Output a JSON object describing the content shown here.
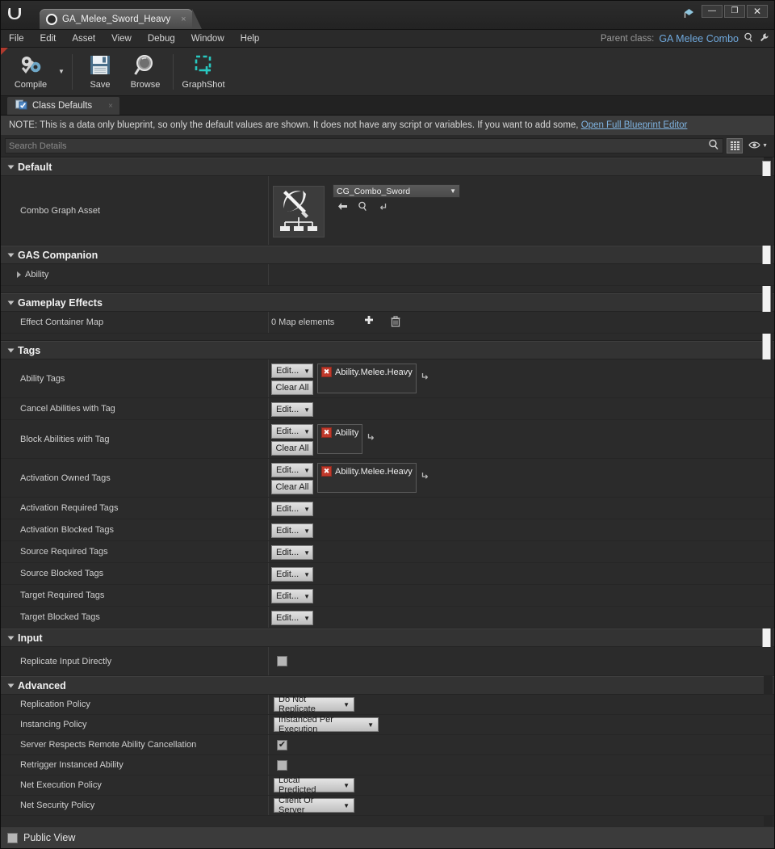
{
  "window": {
    "tab_title": "GA_Melee_Sword_Heavy",
    "tab_close": "×",
    "minimize": "—",
    "maximize": "❐",
    "close": "✕",
    "logo": "U"
  },
  "menubar": {
    "items": [
      "File",
      "Edit",
      "Asset",
      "View",
      "Debug",
      "Window",
      "Help"
    ],
    "parent_class_label": "Parent class:",
    "parent_class_value": "GA Melee Combo"
  },
  "toolbar": {
    "compile": "Compile",
    "save": "Save",
    "browse": "Browse",
    "graphshot": "GraphShot",
    "graphshot_color": "#28c8c0"
  },
  "doctab": {
    "label": "Class Defaults",
    "close": "×"
  },
  "note": {
    "text": "NOTE: This is a data only blueprint, so only the default values are shown.  It does not have any script or variables.  If you want to add some, ",
    "link": "Open Full Blueprint Editor"
  },
  "search": {
    "placeholder": "Search Details",
    "value": ""
  },
  "sections": {
    "default": {
      "title": "Default",
      "combo_graph_asset_label": "Combo Graph Asset",
      "combo_graph_asset_value": "CG_Combo_Sword"
    },
    "gas_companion": {
      "title": "GAS Companion",
      "ability_label": "Ability"
    },
    "gameplay_effects": {
      "title": "Gameplay Effects",
      "effect_container_map_label": "Effect Container Map",
      "effect_container_map_value": "0 Map elements"
    },
    "tags": {
      "title": "Tags",
      "edit_label": "Edit...",
      "clear_all_label": "Clear All",
      "rows": [
        {
          "label": "Ability Tags",
          "tags": [
            "Ability.Melee.Heavy"
          ],
          "has_clear": true
        },
        {
          "label": "Cancel Abilities with Tag",
          "tags": [],
          "has_clear": false
        },
        {
          "label": "Block Abilities with Tag",
          "tags": [
            "Ability"
          ],
          "has_clear": true
        },
        {
          "label": "Activation Owned Tags",
          "tags": [
            "Ability.Melee.Heavy"
          ],
          "has_clear": true
        },
        {
          "label": "Activation Required Tags",
          "tags": [],
          "has_clear": false
        },
        {
          "label": "Activation Blocked Tags",
          "tags": [],
          "has_clear": false
        },
        {
          "label": "Source Required Tags",
          "tags": [],
          "has_clear": false
        },
        {
          "label": "Source Blocked Tags",
          "tags": [],
          "has_clear": false
        },
        {
          "label": "Target Required Tags",
          "tags": [],
          "has_clear": false
        },
        {
          "label": "Target Blocked Tags",
          "tags": [],
          "has_clear": false
        }
      ]
    },
    "input": {
      "title": "Input",
      "replicate_input_directly_label": "Replicate Input Directly",
      "replicate_input_directly_checked": false
    },
    "advanced": {
      "title": "Advanced",
      "replication_policy_label": "Replication Policy",
      "replication_policy_value": "Do Not Replicate",
      "instancing_policy_label": "Instancing Policy",
      "instancing_policy_value": "Instanced Per Execution",
      "server_respects_label": "Server Respects Remote Ability Cancellation",
      "server_respects_checked": true,
      "retrigger_label": "Retrigger Instanced Ability",
      "retrigger_checked": false,
      "net_execution_policy_label": "Net Execution Policy",
      "net_execution_policy_value": "Local Predicted",
      "net_security_policy_label": "Net Security Policy",
      "net_security_policy_value": "Client Or Server"
    }
  },
  "footer": {
    "public_view_label": "Public View",
    "public_view_checked": false
  },
  "icons": {
    "check": "✔",
    "tag_remove": "✖",
    "plus": "✚",
    "trash": "🗑",
    "magnifier": "⌕",
    "revert": "↰",
    "back_arrow": "◄",
    "eye": "◉"
  }
}
